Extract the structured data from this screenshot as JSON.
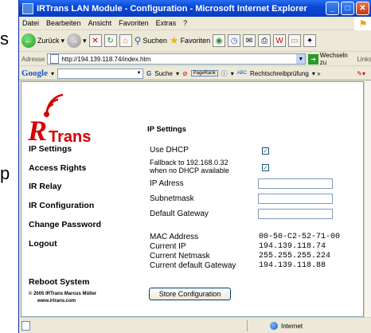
{
  "window": {
    "title": "IRTrans LAN Module - Configuration - Microsoft Internet Explorer"
  },
  "edge_chars": [
    "s",
    "p"
  ],
  "menu": [
    "Datei",
    "Bearbeiten",
    "Ansicht",
    "Favoriten",
    "Extras",
    "?"
  ],
  "toolbar": {
    "back": "Zurück",
    "search": "Suchen",
    "favorites": "Favoriten"
  },
  "address": {
    "label": "Adresse",
    "url": "http://194.139.118.74/index.htm",
    "go": "Wechseln zu",
    "links": "Links"
  },
  "google": {
    "logo": "Google",
    "search": "Suche",
    "pagerank": "PageRank",
    "spell": "Rechtschreibprüfung"
  },
  "logo": {
    "text": "Trans",
    "r": "R"
  },
  "nav": {
    "ip_settings": "IP Settings",
    "access_rights": "Access Rights",
    "ir_relay": "IR Relay",
    "ir_configuration": "IR Configuration",
    "change_password": "Change Password",
    "logout": "Logout",
    "reboot": "Reboot System"
  },
  "footer": {
    "copyright": "© 2005 IRTrans Marcus Müller",
    "url": "www.irtrans.com"
  },
  "settings": {
    "title": "IP Settings",
    "use_dhcp": "Use DHCP",
    "fallback_line1": "Fallback to 192.168.0.32",
    "fallback_line2": "when no DHCP available",
    "ip_address": "IP Adress",
    "subnetmask": "Subnetmask",
    "gateway": "Default Gateway",
    "mac_label": "MAC Address",
    "mac_value": "00-50-C2-52-71-00",
    "current_ip_label": "Current IP",
    "current_ip_value": "194.139.118.74",
    "netmask_label": "Current Netmask",
    "netmask_value": "255.255.255.224",
    "current_gw_label": "Current default Gateway",
    "current_gw_value": "194.139.118.88",
    "store_button": "Store Configuration",
    "use_dhcp_checked": true,
    "fallback_checked": true
  },
  "status": {
    "zone": "Internet"
  }
}
